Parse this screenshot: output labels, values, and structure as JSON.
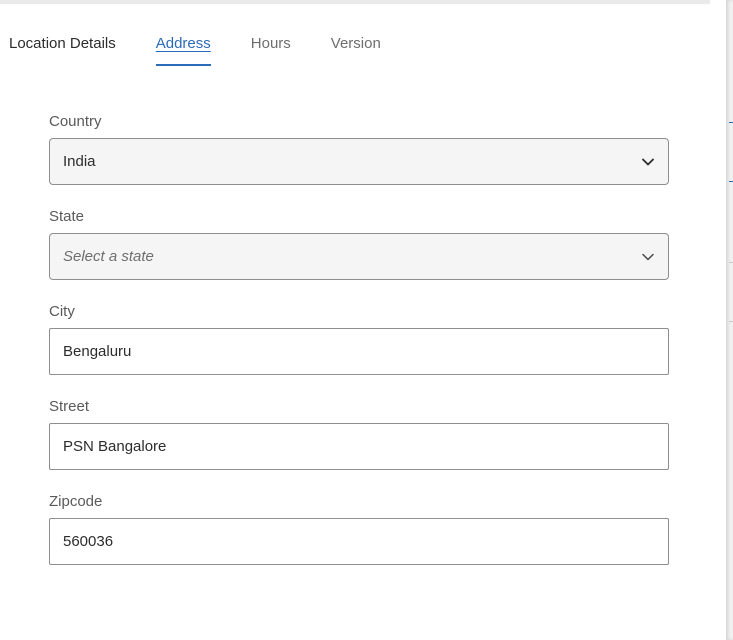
{
  "tabs": {
    "location_details": "Location Details",
    "address": "Address",
    "hours": "Hours",
    "version": "Version"
  },
  "form": {
    "country": {
      "label": "Country",
      "value": "India"
    },
    "state": {
      "label": "State",
      "placeholder": "Select a state"
    },
    "city": {
      "label": "City",
      "value": "Bengaluru"
    },
    "street": {
      "label": "Street",
      "value": "PSN Bangalore"
    },
    "zipcode": {
      "label": "Zipcode",
      "value": "560036"
    }
  },
  "colors": {
    "accent": "#2c6bb5",
    "border": "#8e8e8e",
    "select_background": "#f5f5f5"
  },
  "icons": {
    "dropdown": "chevron-down-icon"
  }
}
